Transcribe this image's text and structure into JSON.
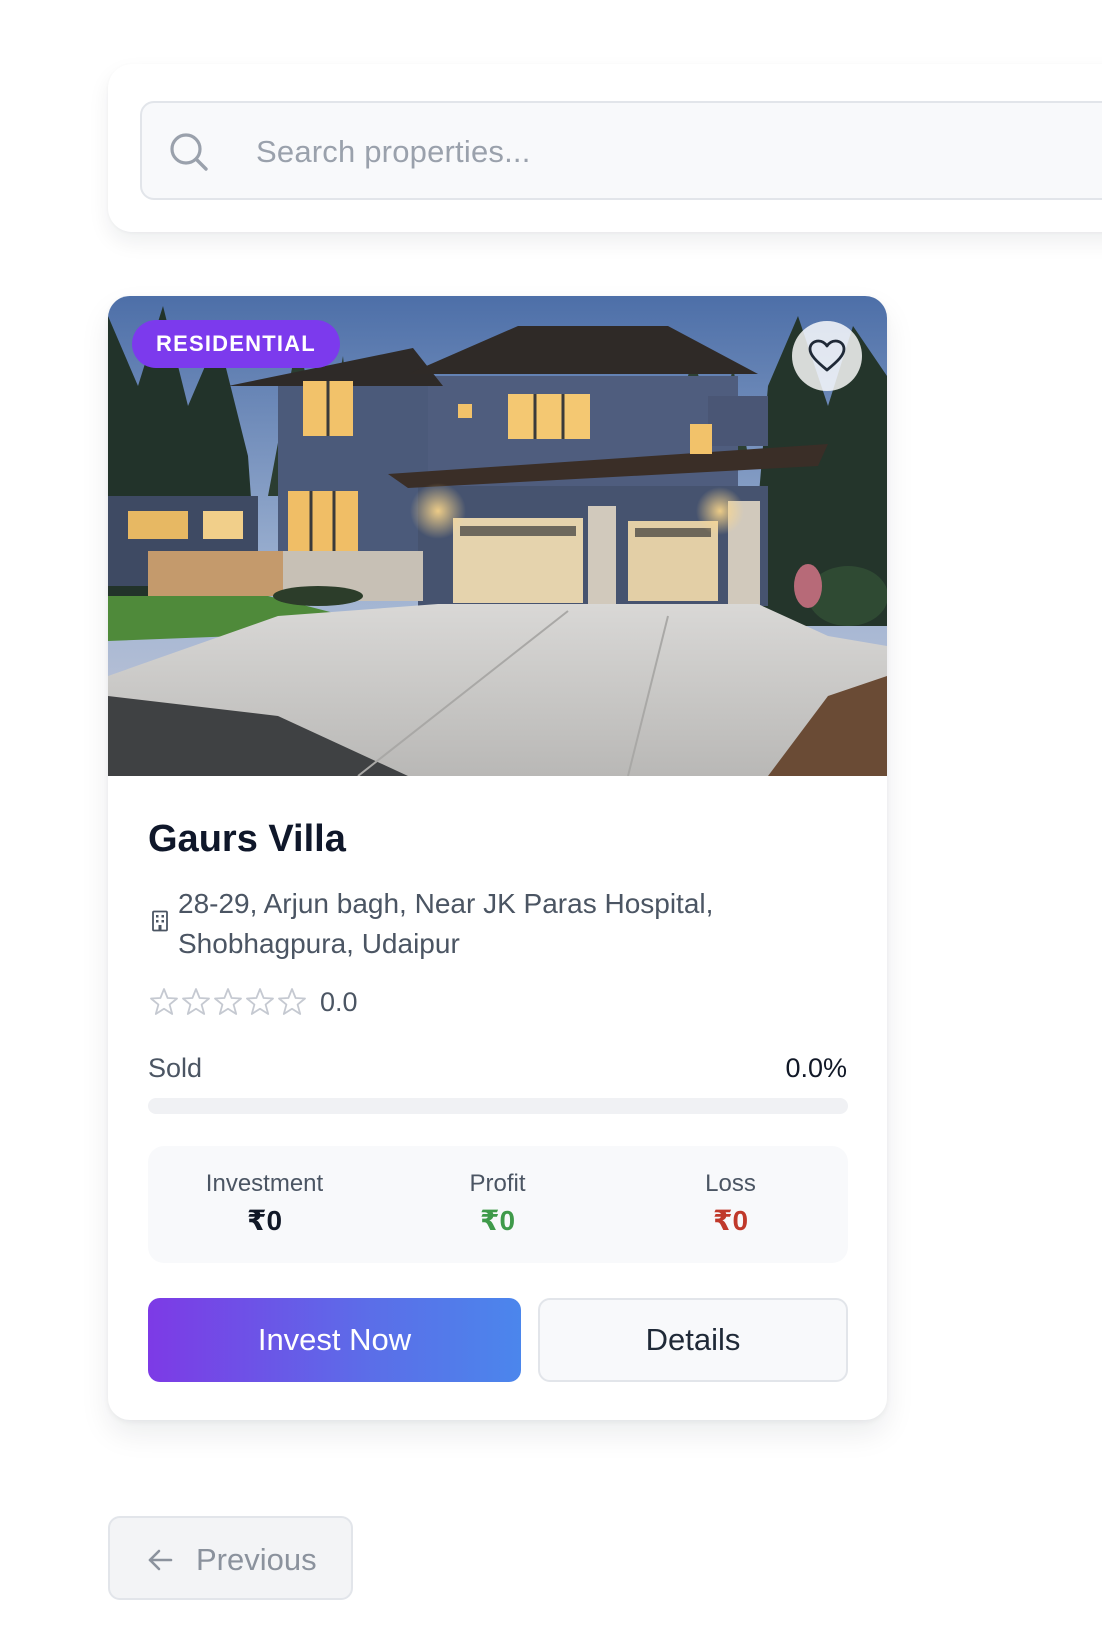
{
  "search": {
    "placeholder": "Search properties..."
  },
  "property": {
    "type_badge": "RESIDENTIAL",
    "title": "Gaurs Villa",
    "address": "28-29, Arjun bagh, Near JK Paras Hospital, Shobhagpura, Udaipur",
    "rating": {
      "stars_filled": 0,
      "stars_total": 5,
      "value": "0.0"
    },
    "sold": {
      "label": "Sold",
      "percent_text": "0.0%",
      "fraction": 0.0
    },
    "stats": {
      "investment": {
        "label": "Investment",
        "value": "₹0"
      },
      "profit": {
        "label": "Profit",
        "value": "₹0"
      },
      "loss": {
        "label": "Loss",
        "value": "₹0"
      }
    },
    "actions": {
      "invest_label": "Invest Now",
      "details_label": "Details"
    },
    "icons": {
      "favorite": "heart-icon",
      "address": "building-icon",
      "rating": "star-icon"
    }
  },
  "pagination": {
    "previous_label": "Previous",
    "previous_icon": "arrow-left-icon"
  },
  "colors": {
    "accent": "#7c3aed",
    "gradient_end": "#4b86ec",
    "profit": "#3f9a4a",
    "loss": "#c0392b"
  }
}
